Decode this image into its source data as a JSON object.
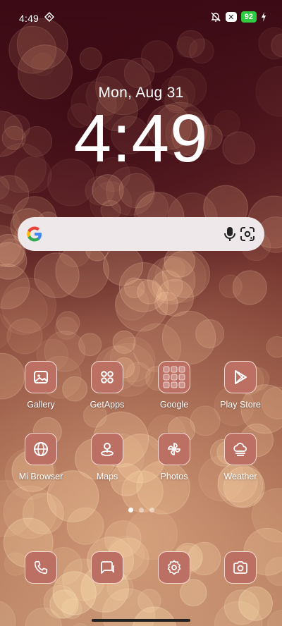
{
  "status_bar": {
    "time": "4:49",
    "battery": "92",
    "icons": [
      "nav-diamond-icon",
      "bell-muted-icon",
      "x-badge-icon",
      "battery-icon",
      "charging-bolt-icon"
    ]
  },
  "lockscreen": {
    "date": "Mon, Aug 31",
    "clock": "4:49"
  },
  "search_bar": {
    "icons": [
      "google-g-icon",
      "mic-icon",
      "google-lens-icon"
    ]
  },
  "apps": [
    {
      "label": "Gallery",
      "icon": "gallery-icon"
    },
    {
      "label": "GetApps",
      "icon": "getapps-icon"
    },
    {
      "label": "Google",
      "icon": "google-folder-icon"
    },
    {
      "label": "Play Store",
      "icon": "play-store-icon"
    },
    {
      "label": "Mi Browser",
      "icon": "globe-icon"
    },
    {
      "label": "Maps",
      "icon": "maps-pin-icon"
    },
    {
      "label": "Photos",
      "icon": "pinwheel-icon"
    },
    {
      "label": "Weather",
      "icon": "weather-icon"
    }
  ],
  "page_indicator": {
    "pages": 3,
    "current": 1
  },
  "dock": [
    {
      "icon": "phone-icon"
    },
    {
      "icon": "messages-icon"
    },
    {
      "icon": "settings-icon"
    },
    {
      "icon": "camera-icon"
    }
  ],
  "colors": {
    "tile": "#bc7064",
    "battery_green": "#2ecc40",
    "search_bg": "#eee8ea"
  }
}
